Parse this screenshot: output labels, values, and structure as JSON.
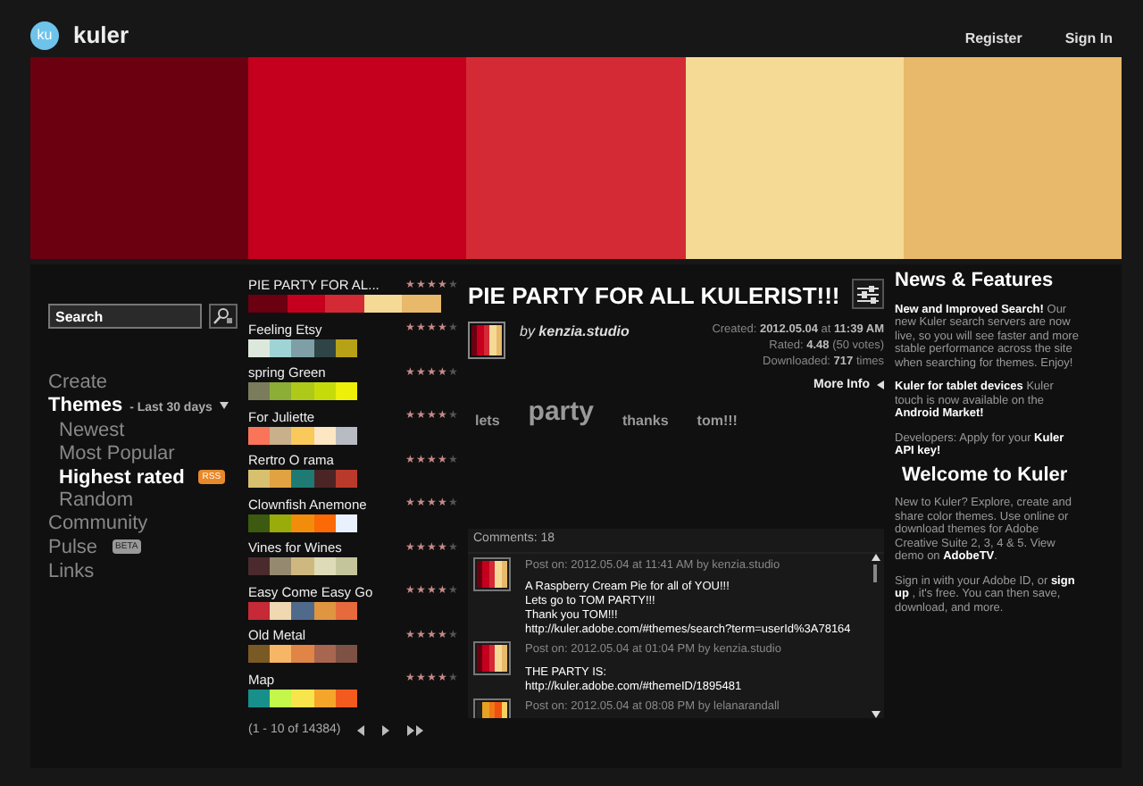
{
  "header": {
    "logo_mark": "ku",
    "logo_text": "kuler",
    "links": [
      "Register",
      "Sign In"
    ]
  },
  "hero_swatches": [
    {
      "color": "#6b0010"
    },
    {
      "color": "#c4001e"
    },
    {
      "color": "#d42a35"
    },
    {
      "color": "#f5da96"
    },
    {
      "color": "#e8b96a"
    }
  ],
  "search": {
    "placeholder": "Search"
  },
  "nav": [
    {
      "label": "Create",
      "selected": false
    },
    {
      "label": "Themes",
      "selected": true,
      "filter": "- Last 30 days",
      "children": [
        {
          "label": "Newest",
          "selected": false
        },
        {
          "label": "Most Popular",
          "selected": false
        },
        {
          "label": "Highest rated",
          "selected": true,
          "badge": "RSS"
        },
        {
          "label": "Random",
          "selected": false
        }
      ]
    },
    {
      "label": "Community",
      "selected": false
    },
    {
      "label": "Pulse",
      "selected": false,
      "badge": "BETA"
    },
    {
      "label": "Links",
      "selected": false
    }
  ],
  "themes": [
    {
      "name": "PIE PARTY  FOR AL...",
      "selected": true,
      "stars": 4,
      "colors": [
        {
          "color": "#6b0010"
        },
        {
          "color": "#c4001e"
        },
        {
          "color": "#d42a35"
        },
        {
          "color": "#f5da96"
        },
        {
          "color": "#e8b96a"
        }
      ]
    },
    {
      "name": "Feeling Etsy",
      "selected": false,
      "stars": 4,
      "colors": [
        {
          "color": "#dde8dc"
        },
        {
          "color": "#9fd4d6"
        },
        {
          "color": "#7e9fa6"
        },
        {
          "color": "#2e4447"
        },
        {
          "color": "#b7a117"
        }
      ]
    },
    {
      "name": "spring Green",
      "selected": false,
      "stars": 4,
      "colors": [
        {
          "color": "#7a7c5c"
        },
        {
          "color": "#8cae36"
        },
        {
          "color": "#aec91a"
        },
        {
          "color": "#c6dc0a"
        },
        {
          "color": "#eef00a"
        }
      ]
    },
    {
      "name": "For Juliette",
      "selected": false,
      "stars": 4,
      "colors": [
        {
          "color": "#fa7459"
        },
        {
          "color": "#c8b08a"
        },
        {
          "color": "#f9c95b"
        },
        {
          "color": "#fde6c3"
        },
        {
          "color": "#b8bcc2"
        }
      ]
    },
    {
      "name": "Rertro O rama",
      "selected": false,
      "stars": 4,
      "colors": [
        {
          "color": "#d7c16f"
        },
        {
          "color": "#e1a341"
        },
        {
          "color": "#207a74"
        },
        {
          "color": "#4b2525"
        },
        {
          "color": "#b93a2b"
        }
      ]
    },
    {
      "name": "Clownfish Anemone",
      "selected": false,
      "stars": 4,
      "colors": [
        {
          "color": "#3c5a10"
        },
        {
          "color": "#99ac0a"
        },
        {
          "color": "#f28c0b"
        },
        {
          "color": "#fb6a06"
        },
        {
          "color": "#e8f1fd"
        }
      ]
    },
    {
      "name": "Vines for Wines",
      "selected": false,
      "stars": 4,
      "colors": [
        {
          "color": "#4b2a2e"
        },
        {
          "color": "#958a70"
        },
        {
          "color": "#cfb880"
        },
        {
          "color": "#dedbb9"
        },
        {
          "color": "#c5c59c"
        }
      ]
    },
    {
      "name": "Easy Come Easy Go",
      "selected": false,
      "stars": 4,
      "colors": [
        {
          "color": "#c52a36"
        },
        {
          "color": "#f0d8b1"
        },
        {
          "color": "#506a8c"
        },
        {
          "color": "#e09540"
        },
        {
          "color": "#e66a3b"
        }
      ]
    },
    {
      "name": "Old Metal",
      "selected": false,
      "stars": 4,
      "colors": [
        {
          "color": "#7a5a24"
        },
        {
          "color": "#f7b666"
        },
        {
          "color": "#e08546"
        },
        {
          "color": "#a86550"
        },
        {
          "color": "#7d5144"
        }
      ]
    },
    {
      "name": "Map",
      "selected": false,
      "stars": 4,
      "colors": [
        {
          "color": "#17908c"
        },
        {
          "color": "#c3f74a"
        },
        {
          "color": "#f8e44b"
        },
        {
          "color": "#f5a52a"
        },
        {
          "color": "#f25a1e"
        }
      ]
    }
  ],
  "pagination": "(1 - 10 of 14384)",
  "detail": {
    "title": "PIE PARTY  FOR ALL KULERIST!!!",
    "by": "by",
    "author": "kenzia.studio",
    "thumb_colors": [
      {
        "color": "#6b0010"
      },
      {
        "color": "#c4001e"
      },
      {
        "color": "#d42a35"
      },
      {
        "color": "#f5da96"
      },
      {
        "color": "#e8b96a"
      }
    ],
    "meta": [
      "Created: **2012.05.04** at **11:39 AM**",
      "Rated: **4.48** (50 votes)",
      "Downloaded: **717** times"
    ],
    "more_info": "More Info",
    "tags": [
      {
        "label": "lets",
        "kind": "small"
      },
      {
        "label": "party",
        "kind": "large"
      },
      {
        "label": "thanks",
        "kind": "small"
      },
      {
        "label": "tom!!!",
        "kind": "small"
      }
    ]
  },
  "comments": {
    "header": "Comments: 18",
    "items": [
      {
        "posted": "Post on: 2012.05.04 at 11:41 AM by kenzia.studio",
        "colors": [
          {
            "color": "#6b0010"
          },
          {
            "color": "#c4001e"
          },
          {
            "color": "#d42a35"
          },
          {
            "color": "#f5da96"
          },
          {
            "color": "#e8b96a"
          }
        ],
        "lines": [
          "A Raspberry Cream Pie  for all of YOU!!!",
          "Lets go to TOM PARTY!!!",
          "Thank you TOM!!!",
          "http://kuler.adobe.com/#themes/search?term=userId%3A78164"
        ]
      },
      {
        "posted": "Post on: 2012.05.04 at 01:04 PM by kenzia.studio",
        "colors": [
          {
            "color": "#6b0010"
          },
          {
            "color": "#c4001e"
          },
          {
            "color": "#d42a35"
          },
          {
            "color": "#f5da96"
          },
          {
            "color": "#e8b96a"
          }
        ],
        "lines": [
          "THE PARTY IS:",
          "http://kuler.adobe.com/#themeID/1895481"
        ]
      },
      {
        "posted": "Post on: 2012.05.04 at 08:08 PM by lelanarandall",
        "colors": [
          {
            "color": "#222222"
          },
          {
            "color": "#e8a020"
          },
          {
            "color": "#f07818"
          },
          {
            "color": "#f05010"
          },
          {
            "color": "#f8d060"
          }
        ]
      }
    ]
  },
  "news": {
    "title": "News & Features",
    "paragraphs": [
      "**New and Improved Search!** Our new Kuler search servers are now live, so you will see faster and more stable performance across the site when searching for themes.  Enjoy!",
      "**Kuler for tablet devices** Kuler touch is now available on the **Android Market!**",
      "Developers: Apply for your **Kuler API key!**"
    ],
    "welcome_title": "Welcome to Kuler",
    "welcome_paragraphs": [
      "New to Kuler? Explore, create and share color themes. Use online or download themes for Adobe Creative Suite 2, 3, 4 & 5. View demo on **AdobeTV**.",
      "Sign in with your Adobe ID, or **sign up** , it's free. You can then save, download, and more."
    ]
  }
}
